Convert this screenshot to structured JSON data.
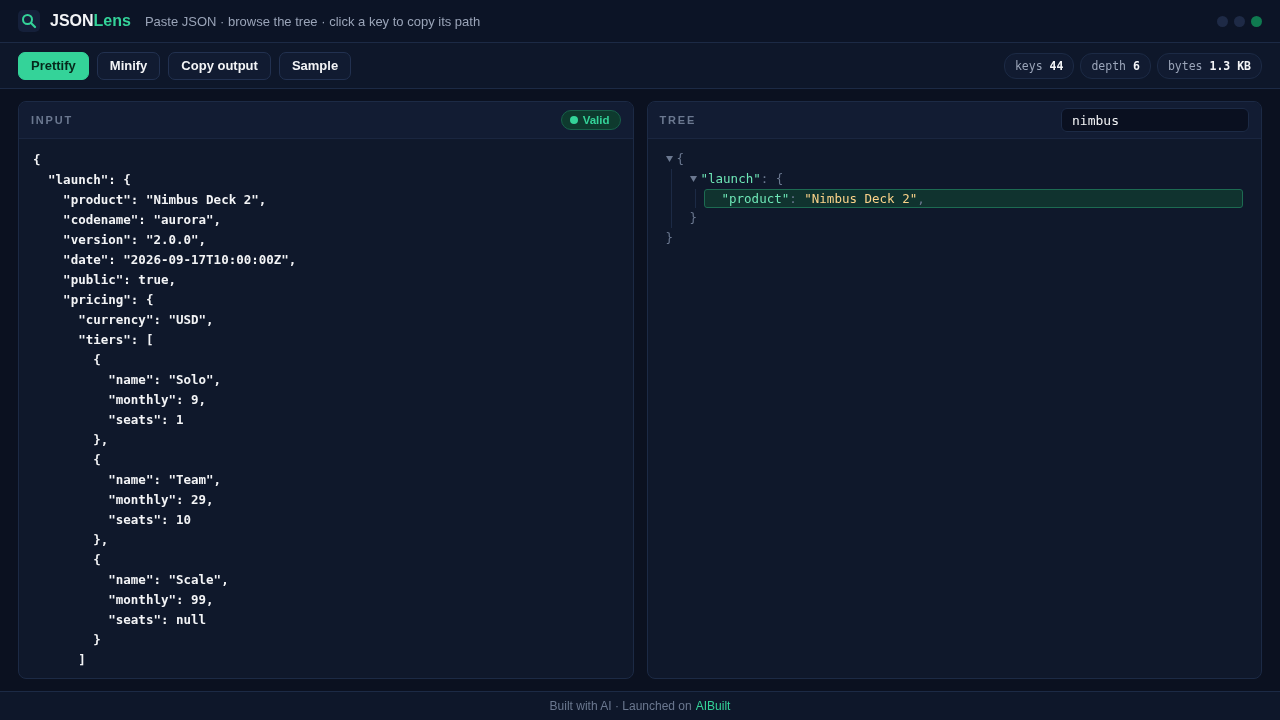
{
  "header": {
    "logo": {
      "part_1": "JSON",
      "part_2": "Lens"
    },
    "tagline": "Paste JSON · browse the tree · click a key to copy its path",
    "window_dots": [
      {
        "color": "#1e2a46"
      },
      {
        "color": "#1e2a46"
      },
      {
        "color": "#0f7a50"
      }
    ]
  },
  "toolbar": {
    "buttons": [
      {
        "label": "Prettify",
        "selected": true
      },
      {
        "label": "Minify",
        "selected": false
      },
      {
        "label": "Copy output",
        "selected": false
      },
      {
        "label": "Sample",
        "selected": false
      }
    ],
    "stats": [
      {
        "label": "keys",
        "value": "44"
      },
      {
        "label": "depth",
        "value": "6"
      },
      {
        "label": "bytes",
        "value": "1.3 KB"
      }
    ]
  },
  "input_panel": {
    "title": "INPUT",
    "status": {
      "label": "Valid",
      "valid": true
    },
    "lines": [
      "{",
      "  \"launch\": {",
      "    \"product\": \"Nimbus Deck 2\",",
      "    \"codename\": \"aurora\",",
      "    \"version\": \"2.0.0\",",
      "    \"date\": \"2026-09-17T10:00:00Z\",",
      "    \"public\": true,",
      "    \"pricing\": {",
      "      \"currency\": \"USD\",",
      "      \"tiers\": [",
      "        {",
      "          \"name\": \"Solo\",",
      "          \"monthly\": 9,",
      "          \"seats\": 1",
      "        },",
      "        {",
      "          \"name\": \"Team\",",
      "          \"monthly\": 29,",
      "          \"seats\": 10",
      "        },",
      "        {",
      "          \"name\": \"Scale\",",
      "          \"monthly\": 99,",
      "          \"seats\": null",
      "        }",
      "      ]"
    ]
  },
  "tree_panel": {
    "title": "TREE",
    "search": {
      "value": "nimbus"
    },
    "root": {
      "open": "{",
      "close": "}",
      "expanded": true,
      "children": [
        {
          "key": "\"launch\"",
          "colon": ":",
          "open": "{",
          "close": "}",
          "expanded": true,
          "children": [
            {
              "key": "\"product\"",
              "colon": ":",
              "value": "\"Nimbus Deck 2\"",
              "comma": ",",
              "selected": true
            }
          ]
        }
      ]
    }
  },
  "footer": {
    "text": "Built with AI · Launched on",
    "link": "AIBuilt"
  }
}
